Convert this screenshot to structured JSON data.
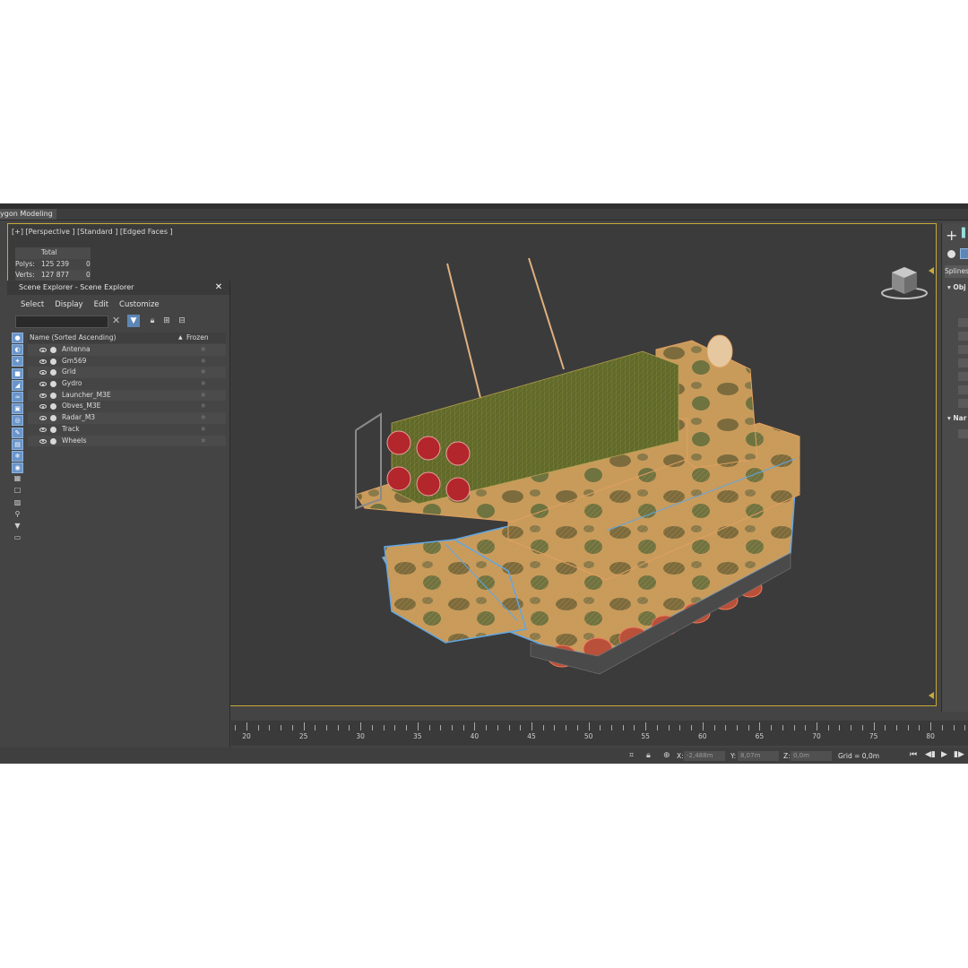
{
  "ribbon": {
    "tab_label": "ygon Modeling"
  },
  "viewport": {
    "label": "[+] [Perspective ] [Standard ] [Edged Faces ]",
    "stats": {
      "header": "Total",
      "polys_label": "Polys:",
      "polys_total": "125 239",
      "polys_sel": "0",
      "verts_label": "Verts:",
      "verts_total": "127 877",
      "verts_sel": "0"
    }
  },
  "scene_explorer": {
    "title": "Scene Explorer - Scene Explorer",
    "close": "✕",
    "menu": [
      "Select",
      "Display",
      "Edit",
      "Customize"
    ],
    "search_value": "",
    "column_name": "Name (Sorted Ascending)",
    "sort_indicator": "▲",
    "column_frozen": "Frozen",
    "items": [
      {
        "label": "Antenna"
      },
      {
        "label": "Gm569"
      },
      {
        "label": "Grid"
      },
      {
        "label": "Gydro"
      },
      {
        "label": "Launcher_M3E"
      },
      {
        "label": "Obves_M3E"
      },
      {
        "label": "Radar_M3"
      },
      {
        "label": "Track"
      },
      {
        "label": "Wheels"
      }
    ],
    "frozen_icon": "❄"
  },
  "command_panel": {
    "create_icon": "+",
    "category": "Splines",
    "rollout_object_type": "Obj",
    "rollout_name": "Nar"
  },
  "timeline": {
    "labels": [
      "20",
      "25",
      "30",
      "35",
      "40",
      "45",
      "50",
      "55",
      "60",
      "65",
      "70",
      "75",
      "80"
    ]
  },
  "status": {
    "x_label": "X:",
    "x_value": "-2,488m",
    "y_label": "Y:",
    "y_value": "8,07m",
    "z_label": "Z:",
    "z_value": "0,0m",
    "grid": "Grid = 0,0m"
  },
  "colors": {
    "viewport_border": "#c7a93a",
    "stats_text": "#e8c43e",
    "selection_blue": "#5c86b5",
    "camo_tan": "#c59a5a",
    "camo_green": "#6f7340"
  }
}
